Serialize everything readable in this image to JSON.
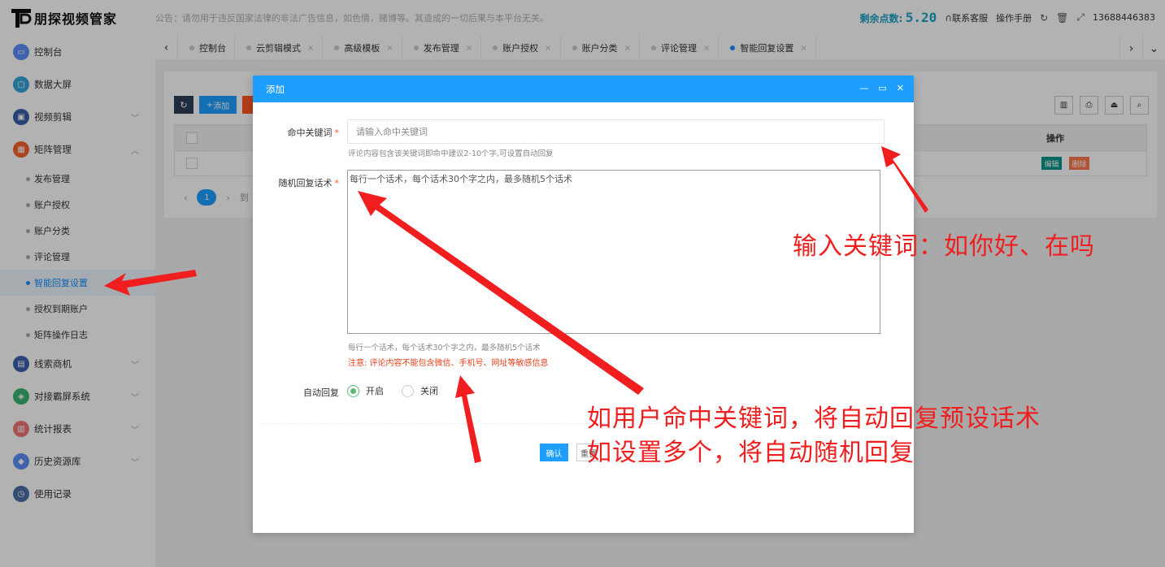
{
  "app": {
    "logo_text": "朋探视频管家"
  },
  "notice": "公告：请勿用于违反国家法律的非法广告信息，如色情，赌博等。其造成的一切后果与本平台无关。",
  "topbar": {
    "points_label": "剩余点数:",
    "points_value": "5.20",
    "support": "联系客服",
    "manual": "操作手册",
    "phone": "13688446383"
  },
  "sidebar": {
    "items": [
      {
        "label": "控制台",
        "icon": "dashboard-icon",
        "color": "#5b8ff9"
      },
      {
        "label": "数据大屏",
        "icon": "screen-icon",
        "color": "#36a3d9"
      },
      {
        "label": "视频剪辑",
        "icon": "video-icon",
        "color": "#3a5fa8"
      },
      {
        "label": "矩阵管理",
        "icon": "matrix-icon",
        "color": "#f5622d"
      }
    ],
    "sub_items": [
      "发布管理",
      "账户授权",
      "账户分类",
      "评论管理",
      "智能回复设置",
      "授权到期账户",
      "矩阵操作日志"
    ],
    "items_after": [
      {
        "label": "线索商机",
        "icon": "leads-icon",
        "color": "#3a5fa8"
      },
      {
        "label": "对接霸屏系统",
        "icon": "system-icon",
        "color": "#3cb371"
      },
      {
        "label": "统计报表",
        "icon": "report-icon",
        "color": "#f07575"
      },
      {
        "label": "历史资源库",
        "icon": "archive-icon",
        "color": "#5b8ff9"
      },
      {
        "label": "使用记录",
        "icon": "history-icon",
        "color": "#4a6fa5"
      }
    ]
  },
  "tabs": [
    "控制台",
    "云剪辑模式",
    "高级模板",
    "发布管理",
    "账户授权",
    "账户分类",
    "评论管理",
    "智能回复设置"
  ],
  "toolbar": {
    "add_label": "添加"
  },
  "table": {
    "op_header": "操作",
    "edit_label": "编辑",
    "delete_label": "删除",
    "page": "1",
    "goto_fragment": "到"
  },
  "modal": {
    "title": "添加",
    "keyword_label": "命中关键词",
    "keyword_placeholder": "请输入命中关键词",
    "keyword_help": "评论内容包含该关键词即命中建议2-10个字,可设置自动回复",
    "reply_label": "随机回复话术",
    "reply_placeholder": "每行一个话术，每个话术30个字之内，最多随机5个话术",
    "reply_help": "每行一个话术，每个话术30个字之内，最多随机5个话术",
    "warning": "注意: 评论内容不能包含微信、手机号、网址等敏感信息",
    "auto_label": "自动回复",
    "on_label": "开启",
    "off_label": "关闭",
    "confirm_label": "确认",
    "reset_label": "重置"
  },
  "annotations": {
    "keyword_tip": "输入关键词：如你好、在吗",
    "reply_tip_1": "如用户命中关键词，将自动回复预设话术",
    "reply_tip_2": "如设置多个，将自动随机回复"
  }
}
